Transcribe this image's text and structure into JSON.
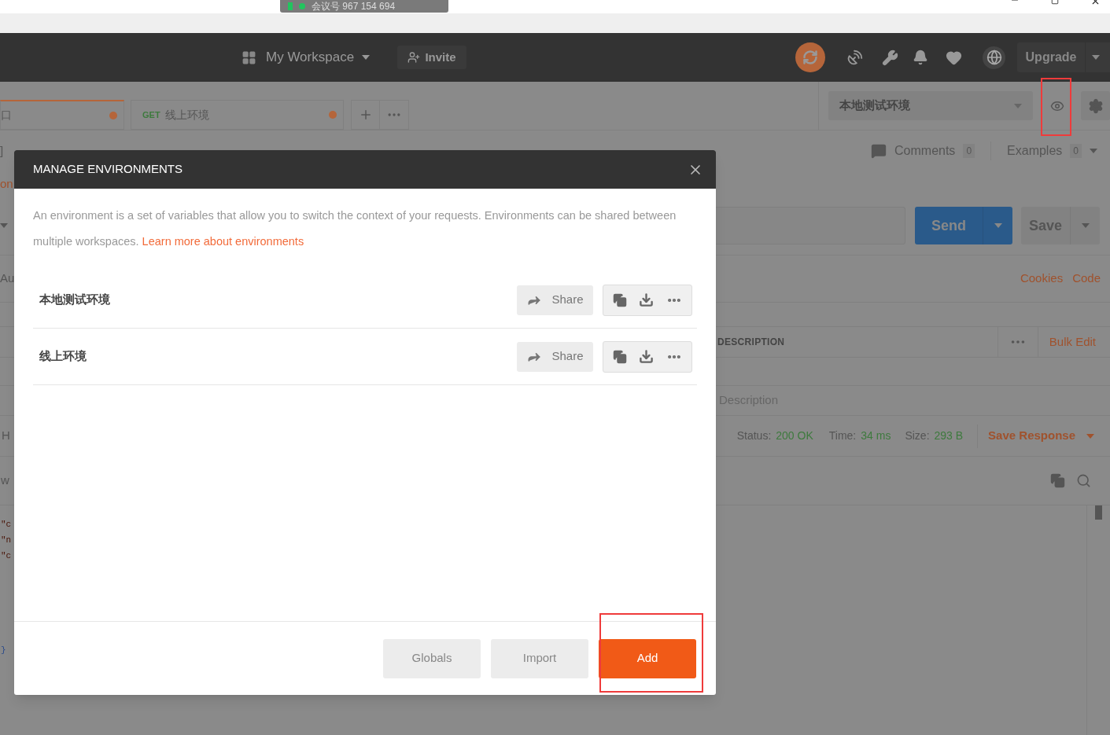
{
  "meeting_badge": {
    "text": "会议号 967 154 694"
  },
  "header": {
    "workspace": "My Workspace",
    "invite": "Invite",
    "upgrade": "Upgrade"
  },
  "tabs": [
    {
      "label": "口",
      "selected": true,
      "unsaved": true
    },
    {
      "method": "GET",
      "label": "线上环境",
      "selected": false,
      "unsaved": true
    }
  ],
  "environment_selector": {
    "value": "本地测试环境",
    "eye_highlighted": true
  },
  "request": {
    "comments_label": "Comments",
    "comments_count": "0",
    "examples_label": "Examples",
    "examples_count": "0",
    "send": "Send",
    "save": "Save",
    "links": [
      "Cookies",
      "Code"
    ],
    "params_header": "DESCRIPTION",
    "bulk_edit": "Bulk Edit",
    "description_placeholder": "Description"
  },
  "response": {
    "status_label": "Status:",
    "status": "200 OK",
    "time_label": "Time:",
    "time": "34 ms",
    "size_label": "Size:",
    "size": "293 B",
    "save_response": "Save Response"
  },
  "left_fragments": [
    "]",
    "on",
    "Au",
    "H",
    "w"
  ],
  "code_fragments": [
    "\"c",
    "\"n",
    "\"c",
    "}"
  ],
  "modal": {
    "title": "MANAGE ENVIRONMENTS",
    "description": "An environment is a set of variables that allow you to switch the context of your requests. Environments can be shared between multiple workspaces.",
    "learn_more": "Learn more about environments",
    "environments": [
      {
        "name": "本地测试环境",
        "share": "Share"
      },
      {
        "name": "线上环境",
        "share": "Share"
      }
    ],
    "buttons": [
      {
        "label": "Globals",
        "kind": "secondary",
        "highlighted": false
      },
      {
        "label": "Import",
        "kind": "secondary",
        "highlighted": false
      },
      {
        "label": "Add",
        "kind": "primary",
        "highlighted": true
      }
    ]
  }
}
